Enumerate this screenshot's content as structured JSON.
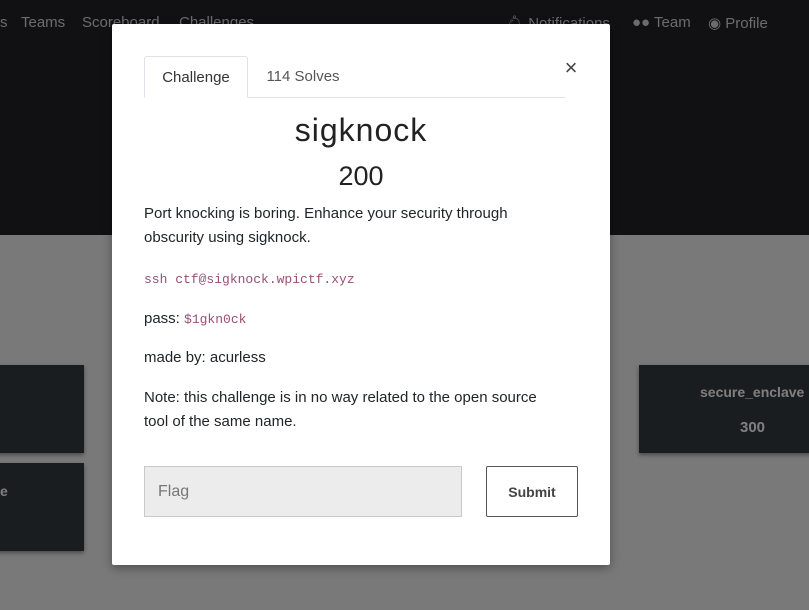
{
  "nav": {
    "left_items": [
      "s",
      "Teams",
      "Scoreboard",
      "Challenges"
    ],
    "notifications": "Notifications",
    "team": "Team",
    "profile": "Profile"
  },
  "cards": {
    "left_top_label": "",
    "left_bottom_label": "e",
    "right": {
      "name": "secure_enclave",
      "value": "300"
    }
  },
  "modal": {
    "tabs": {
      "challenge": "Challenge",
      "solves": "114 Solves"
    },
    "close_symbol": "×",
    "title": "sigknock",
    "points": "200",
    "description_line1": "Port knocking is boring. Enhance your security through obscurity using sigknock.",
    "ssh_command": "ssh ctf@sigknock.wpictf.xyz",
    "pass_label": "pass: ",
    "pass_value": "$1gkn0ck",
    "made_by": "made by: acurless",
    "note": "Note: this challenge is in no way related to the open source tool of the same name.",
    "flag_placeholder": "Flag",
    "flag_value": "",
    "submit_label": "Submit"
  }
}
